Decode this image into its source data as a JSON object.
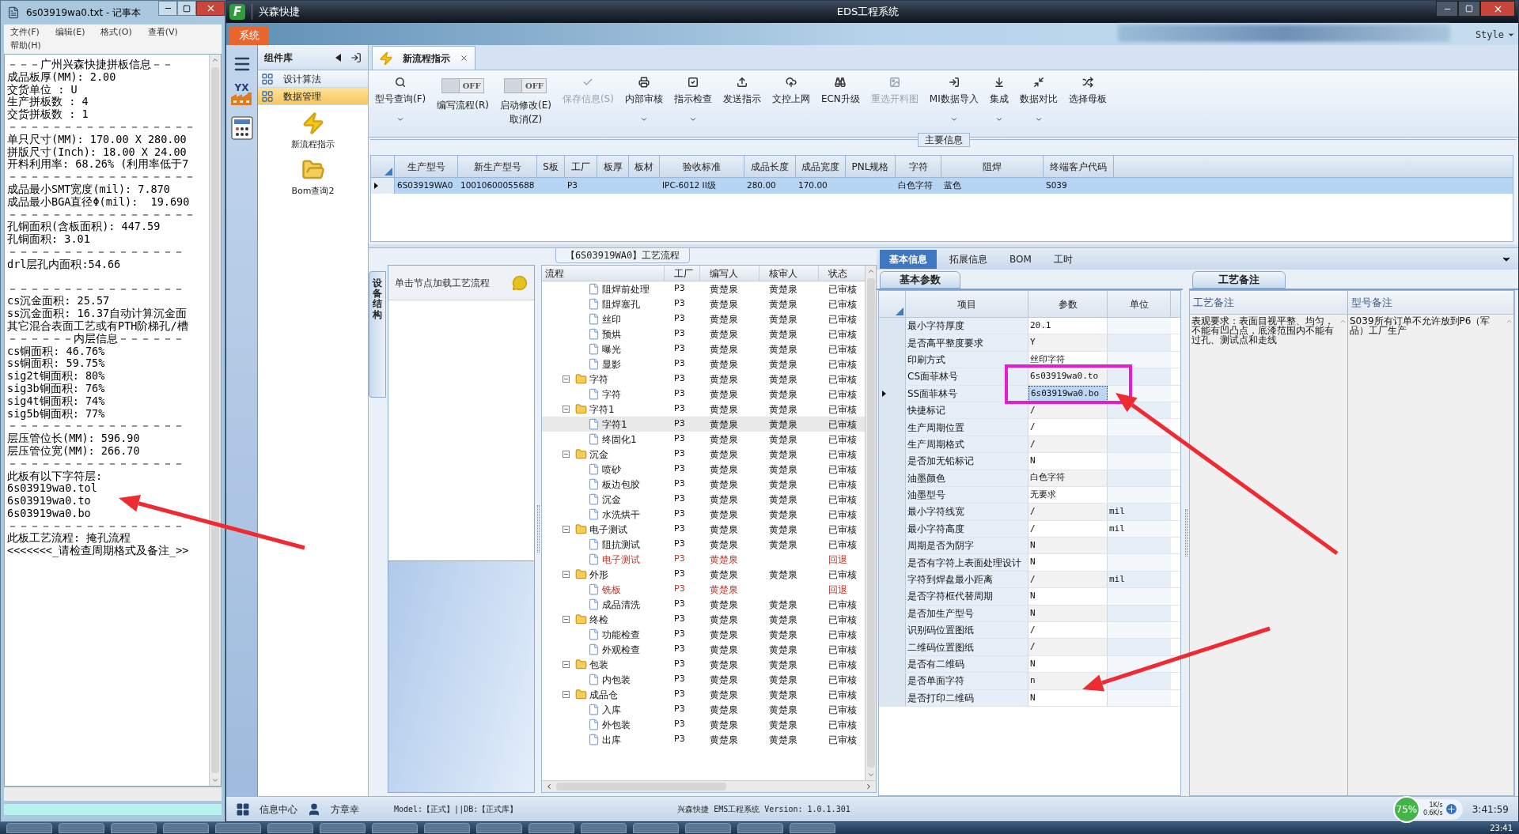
{
  "notepad": {
    "title": "6s03919wa0.txt - 记事本",
    "menu": [
      "文件(F)",
      "编辑(E)",
      "格式(O)",
      "查看(V)",
      "帮助(H)"
    ],
    "blocks": [
      [
        "－－－广州兴森快捷拼板信息－－",
        "成品板厚(MM): 2.00",
        "交货单位 : U",
        "生产拼板数 : 4",
        "交货拼板数 : 1",
        "－－－－－－－－－－－－－－－－－",
        "单只尺寸(MM): 170.00 X 280.00",
        "拼版尺寸(Inch): 18.00 X 24.00",
        "开料利用率: 68.26% (利用率低于7",
        "－－－－－－－－－－－－－－－－－",
        "成品最小SMT宽度(mil): 7.870",
        "成品最小BGA直径Φ(mil):  19.690",
        "－－－－－－－－－－－－－－－－－",
        "孔铜面积(含板面积): 447.59",
        "孔铜面积: 3.01",
        "－－－－－－－－－－－－－－－－",
        "drl层孔内面积:54.66"
      ],
      [
        "－－－－－－－－－－－－－－－－",
        "cs沉金面积: 25.57",
        "ss沉金面积: 16.37自动计算沉金面",
        "其它混合表面工艺或有PTH阶梯孔/槽",
        "－－－－－－内层信息－－－－－－",
        "cs铜面积: 46.76%",
        "ss铜面积: 59.75%",
        "sig2t铜面积: 80%",
        "sig3b铜面积: 76%",
        "sig4t铜面积: 74%",
        "sig5b铜面积: 77%",
        "－－－－－－－－－－－－－－－－",
        "层压管位长(MM): 596.90",
        "层压管位宽(MM): 266.70",
        "－－－－－－－－－－－－－－－－",
        "此板有以下字符层:",
        "6s03919wa0.tol",
        "6s03919wa0.to",
        "6s03919wa0.bo",
        "－－－－－－－－－－－－－－－－",
        "此板工艺流程: 掩孔流程",
        "<<<<<<<_请检查周期格式及备注_>>"
      ]
    ]
  },
  "window": {
    "logo": "F",
    "app_name": "兴森快捷",
    "title": "EDS工程系统",
    "menu_tab": "系统",
    "style_menu": "Style"
  },
  "strip_badge": "YX",
  "library": {
    "title": "组件库",
    "items": [
      {
        "label": "设计算法",
        "selected": false
      },
      {
        "label": "数据管理",
        "selected": true
      }
    ],
    "tools": [
      "新流程指示",
      "Bom查询2"
    ]
  },
  "doc_tab": {
    "label": "新流程指示"
  },
  "toolbar": {
    "items": [
      {
        "kind": "button",
        "label": "型号查询(F)",
        "dropdown": true,
        "disabled": false
      },
      {
        "kind": "toggle",
        "label": "编写流程(R)",
        "switch_text": "OFF",
        "on": false
      },
      {
        "kind": "toggle",
        "label": "启动修改(E)",
        "label_2": "取消(Z)",
        "switch_text": "OFF",
        "on": false
      },
      {
        "kind": "button",
        "label": "保存信息(S)",
        "dropdown": false,
        "disabled": true
      },
      {
        "kind": "button",
        "label": "内部审核",
        "dropdown": true,
        "disabled": false
      },
      {
        "kind": "button",
        "label": "指示检查",
        "dropdown": true,
        "disabled": false
      },
      {
        "kind": "button",
        "label": "发送指示",
        "dropdown": false,
        "disabled": false
      },
      {
        "kind": "button",
        "label": "文控上网",
        "dropdown": false,
        "disabled": false
      },
      {
        "kind": "button",
        "label": "ECN升级",
        "dropdown": false,
        "disabled": false
      },
      {
        "kind": "button",
        "label": "重选开料图",
        "dropdown": false,
        "disabled": true
      },
      {
        "kind": "button",
        "label": "MI数据导入",
        "dropdown": true,
        "disabled": false
      },
      {
        "kind": "button",
        "label": "集成",
        "dropdown": true,
        "disabled": false
      },
      {
        "kind": "button",
        "label": "数据对比",
        "dropdown": true,
        "disabled": false
      },
      {
        "kind": "button",
        "label": "选择母板",
        "dropdown": false,
        "disabled": false
      }
    ]
  },
  "main_info": {
    "title": "主要信息",
    "columns": [
      "生产型号",
      "新生产型号",
      "S板",
      "工厂",
      "板厚",
      "板材",
      "验收标准",
      "成品长度",
      "成品宽度",
      "PNL规格",
      "字符",
      "阻焊",
      "终端客户代码"
    ],
    "rows": [
      {
        "selected": true,
        "cells": [
          "6S03919WA0",
          "10010600055688",
          null,
          "P3",
          null,
          null,
          "IPC-6012 II级",
          "280.00",
          "170.00",
          null,
          "白色字符",
          "蓝色",
          "S039"
        ]
      }
    ]
  },
  "process": {
    "title": "【6S03919WA0】工艺流程",
    "side_tab": "设备结构",
    "hint": "单击节点加载工艺流程",
    "columns": [
      "流程",
      "工厂",
      "编写人",
      "核审人",
      "状态"
    ],
    "nodes": [
      {
        "expanded": true,
        "children": [
          {
            "label": "阻焊前处理",
            "factory": "P3",
            "writer": "黄楚泉",
            "reviewer": "黄楚泉",
            "status": "已审核",
            "rejected": false,
            "selected": false
          },
          {
            "label": "阻焊塞孔",
            "factory": "P3",
            "writer": "黄楚泉",
            "reviewer": "黄楚泉",
            "status": "已审核",
            "rejected": false,
            "selected": false
          },
          {
            "label": "丝印",
            "factory": "P3",
            "writer": "黄楚泉",
            "reviewer": "黄楚泉",
            "status": "已审核",
            "rejected": false,
            "selected": false
          },
          {
            "label": "预烘",
            "factory": "P3",
            "writer": "黄楚泉",
            "reviewer": "黄楚泉",
            "status": "已审核",
            "rejected": false,
            "selected": false
          },
          {
            "label": "曝光",
            "factory": "P3",
            "writer": "黄楚泉",
            "reviewer": "黄楚泉",
            "status": "已审核",
            "rejected": false,
            "selected": false
          },
          {
            "label": "显影",
            "factory": "P3",
            "writer": "黄楚泉",
            "reviewer": "黄楚泉",
            "status": "已审核",
            "rejected": false,
            "selected": false
          }
        ]
      },
      {
        "label": "字符",
        "factory": "P3",
        "writer": "黄楚泉",
        "reviewer": "黄楚泉",
        "status": "已审核",
        "rejected": false,
        "selected": false,
        "expanded": true,
        "children": [
          {
            "label": "字符",
            "factory": "P3",
            "writer": "黄楚泉",
            "reviewer": "黄楚泉",
            "status": "已审核",
            "rejected": false,
            "selected": false
          }
        ]
      },
      {
        "label": "字符1",
        "factory": "P3",
        "writer": "黄楚泉",
        "reviewer": "黄楚泉",
        "status": "已审核",
        "rejected": false,
        "selected": false,
        "expanded": true,
        "children": [
          {
            "label": "字符1",
            "factory": "P3",
            "writer": "黄楚泉",
            "reviewer": "黄楚泉",
            "status": "已审核",
            "rejected": false,
            "selected": true
          },
          {
            "label": "终固化1",
            "factory": "P3",
            "writer": "黄楚泉",
            "reviewer": "黄楚泉",
            "status": "已审核",
            "rejected": false,
            "selected": false
          }
        ]
      },
      {
        "label": "沉金",
        "factory": "P3",
        "writer": "黄楚泉",
        "reviewer": "黄楚泉",
        "status": "已审核",
        "rejected": false,
        "selected": false,
        "expanded": true,
        "children": [
          {
            "label": "喷砂",
            "factory": "P3",
            "writer": "黄楚泉",
            "reviewer": "黄楚泉",
            "status": "已审核",
            "rejected": false,
            "selected": false
          },
          {
            "label": "板边包胶",
            "factory": "P3",
            "writer": "黄楚泉",
            "reviewer": "黄楚泉",
            "status": "已审核",
            "rejected": false,
            "selected": false
          },
          {
            "label": "沉金",
            "factory": "P3",
            "writer": "黄楚泉",
            "reviewer": "黄楚泉",
            "status": "已审核",
            "rejected": false,
            "selected": false
          },
          {
            "label": "水洗烘干",
            "factory": "P3",
            "writer": "黄楚泉",
            "reviewer": "黄楚泉",
            "status": "已审核",
            "rejected": false,
            "selected": false
          }
        ]
      },
      {
        "label": "电子测试",
        "factory": "P3",
        "writer": "黄楚泉",
        "reviewer": "黄楚泉",
        "status": "已审核",
        "rejected": false,
        "selected": false,
        "expanded": true,
        "children": [
          {
            "label": "阻抗测试",
            "factory": "P3",
            "writer": "黄楚泉",
            "reviewer": "黄楚泉",
            "status": "已审核",
            "rejected": false,
            "selected": false
          },
          {
            "label": "电子测试",
            "factory": "P3",
            "writer": "黄楚泉",
            "status": "回退",
            "rejected": true,
            "selected": false
          }
        ]
      },
      {
        "label": "外形",
        "factory": "P3",
        "writer": "黄楚泉",
        "reviewer": "黄楚泉",
        "status": "已审核",
        "rejected": false,
        "selected": false,
        "expanded": true,
        "children": [
          {
            "label": "铣板",
            "factory": "P3",
            "writer": "黄楚泉",
            "status": "回退",
            "rejected": true,
            "selected": false
          },
          {
            "label": "成品清洗",
            "factory": "P3",
            "writer": "黄楚泉",
            "reviewer": "黄楚泉",
            "status": "已审核",
            "rejected": false,
            "selected": false
          }
        ]
      },
      {
        "label": "终检",
        "factory": "P3",
        "writer": "黄楚泉",
        "reviewer": "黄楚泉",
        "status": "已审核",
        "rejected": false,
        "selected": false,
        "expanded": true,
        "children": [
          {
            "label": "功能检查",
            "factory": "P3",
            "writer": "黄楚泉",
            "reviewer": "黄楚泉",
            "status": "已审核",
            "rejected": false,
            "selected": false
          },
          {
            "label": "外观检查",
            "factory": "P3",
            "writer": "黄楚泉",
            "reviewer": "黄楚泉",
            "status": "已审核",
            "rejected": false,
            "selected": false
          }
        ]
      },
      {
        "label": "包装",
        "factory": "P3",
        "writer": "黄楚泉",
        "reviewer": "黄楚泉",
        "status": "已审核",
        "rejected": false,
        "selected": false,
        "expanded": true,
        "children": [
          {
            "label": "内包装",
            "factory": "P3",
            "writer": "黄楚泉",
            "reviewer": "黄楚泉",
            "status": "已审核",
            "rejected": false,
            "selected": false
          }
        ]
      },
      {
        "label": "成品仓",
        "factory": "P3",
        "writer": "黄楚泉",
        "reviewer": "黄楚泉",
        "status": "已审核",
        "rejected": false,
        "selected": false,
        "expanded": true,
        "children": [
          {
            "label": "入库",
            "factory": "P3",
            "writer": "黄楚泉",
            "reviewer": "黄楚泉",
            "status": "已审核",
            "rejected": false,
            "selected": false
          },
          {
            "label": "外包装",
            "factory": "P3",
            "writer": "黄楚泉",
            "reviewer": "黄楚泉",
            "status": "已审核",
            "rejected": false,
            "selected": false
          },
          {
            "label": "出库",
            "factory": "P3",
            "writer": "黄楚泉",
            "reviewer": "黄楚泉",
            "status": "已审核",
            "rejected": false,
            "selected": false
          }
        ]
      }
    ]
  },
  "detail_tabs": [
    {
      "label": "基本信息",
      "selected": true
    },
    {
      "label": "拓展信息",
      "selected": false
    },
    {
      "label": "BOM",
      "selected": false
    },
    {
      "label": "工时",
      "selected": false
    }
  ],
  "params": {
    "tab": "基本参数",
    "columns": [
      "项目",
      "参数",
      "单位"
    ],
    "rows": [
      {
        "item": "最小字符厚度",
        "value": "20.1",
        "selected": false
      },
      {
        "item": "是否高平整度要求",
        "value": "Y",
        "selected": false
      },
      {
        "item": "印刷方式",
        "value": "丝印字符",
        "selected": false
      },
      {
        "item": "CS面菲林号",
        "value": "6s03919wa0.to",
        "selected": false
      },
      {
        "item": "SS面菲林号",
        "value": "6s03919wa0.bo",
        "selected": true
      },
      {
        "item": "快捷标记",
        "value": "/",
        "selected": false
      },
      {
        "item": "生产周期位置",
        "value": "/",
        "selected": false
      },
      {
        "item": "生产周期格式",
        "value": "/",
        "selected": false
      },
      {
        "item": "是否加无铅标记",
        "value": "N",
        "selected": false
      },
      {
        "item": "油墨颜色",
        "value": "白色字符",
        "selected": false
      },
      {
        "item": "油墨型号",
        "value": "无要求",
        "selected": false
      },
      {
        "item": "最小字符线宽",
        "value": "/",
        "unit": "mil",
        "selected": false
      },
      {
        "item": "最小字符高度",
        "value": "/",
        "unit": "mil",
        "selected": false
      },
      {
        "item": "周期是否为阴字",
        "value": "N",
        "selected": false
      },
      {
        "item": "是否有字符上表面处理设计",
        "value": "N",
        "selected": false
      },
      {
        "item": "字符到焊盘最小距离",
        "value": "/",
        "unit": "mil",
        "selected": false
      },
      {
        "item": "是否字符框代替周期",
        "value": "N",
        "selected": false
      },
      {
        "item": "是否加生产型号",
        "value": "N",
        "selected": false
      },
      {
        "item": "识别码位置图纸",
        "value": "/",
        "selected": false
      },
      {
        "item": "二维码位置图纸",
        "value": "/",
        "selected": false
      },
      {
        "item": "是否有二维码",
        "value": "N",
        "selected": false
      },
      {
        "item": "是否单面字符",
        "value": "n",
        "selected": false
      },
      {
        "item": "是否打印二维码",
        "value": "N",
        "selected": false
      }
    ]
  },
  "notes": {
    "tab": "工艺备注",
    "columns": [
      {
        "title": "工艺备注",
        "text": "表观要求：表面目视平整、均匀，不能有凹凸点，底漆范围内不能有过孔、测试点和走线"
      },
      {
        "title": "型号备注",
        "text": "S039所有订单不允许放到P6（军品）工厂生产"
      }
    ]
  },
  "status_bar": {
    "info": "信息中心",
    "user": "方章幸",
    "model": "Model:【正式】||DB:【正式库】",
    "version": "兴森快捷 EMS工程系统 Version: 1.0.1.301",
    "usage": "75%",
    "up": "1K/s",
    "down": "0.6K/s",
    "time": "3:41:59"
  },
  "taskbar": {
    "clock": "23:41"
  }
}
